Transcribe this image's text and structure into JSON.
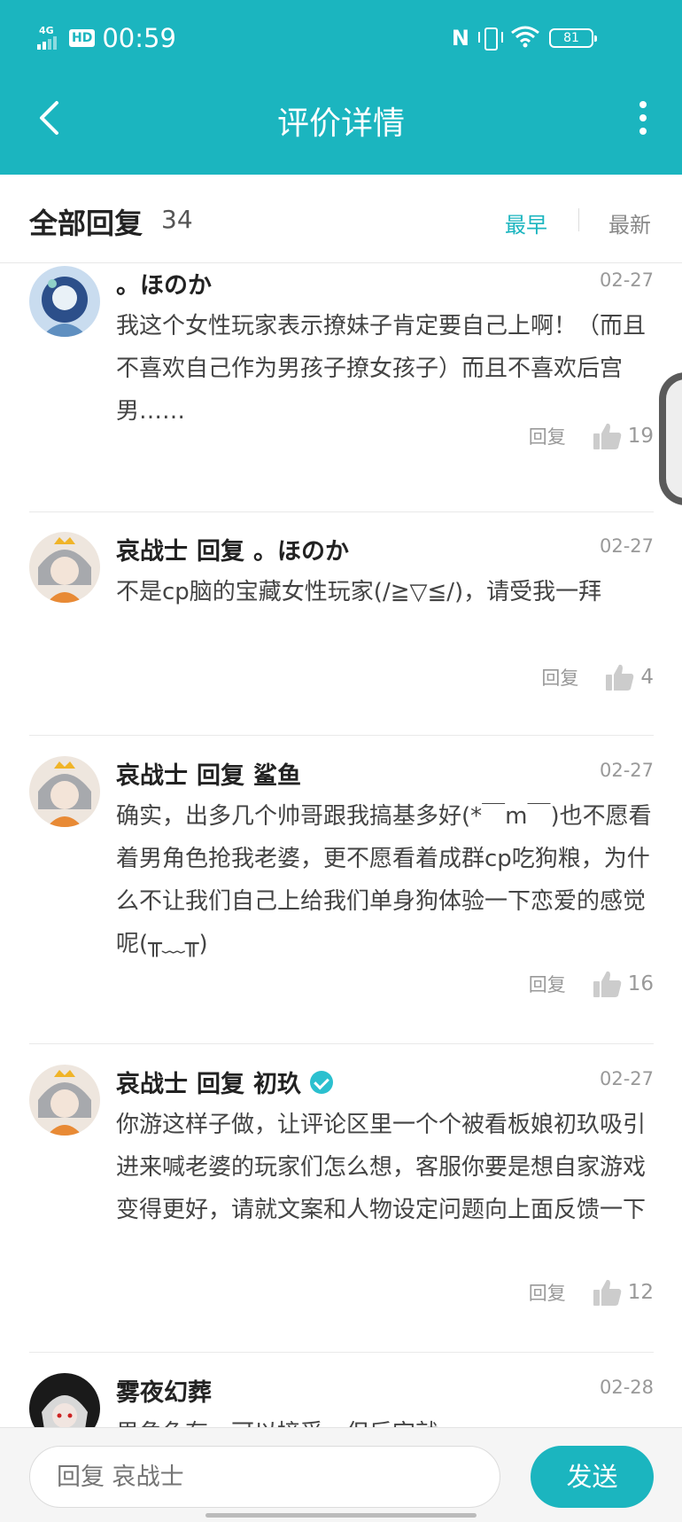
{
  "status_bar": {
    "network": "4G",
    "hd": "HD",
    "time": "00:59",
    "nfc": "N",
    "battery": "81"
  },
  "header": {
    "title": "评价详情"
  },
  "sort_bar": {
    "all_replies_label": "全部回复",
    "count": "34",
    "sort_earliest": "最早",
    "sort_latest": "最新"
  },
  "comments": [
    {
      "author": "。ほのか",
      "reply_word": "",
      "reply_to": "",
      "date": "02-27",
      "text": "我这个女性玩家表示撩妹子肯定要自己上啊！（而且不喜欢自己作为男孩子撩女孩子）而且不喜欢后宫男……",
      "reply_label": "回复",
      "likes": "19"
    },
    {
      "author": "哀战士",
      "reply_word": "回复",
      "reply_to": "。ほのか",
      "date": "02-27",
      "text": "不是cp脑的宝藏女性玩家(/≧▽≦/)，请受我一拜",
      "reply_label": "回复",
      "likes": "4"
    },
    {
      "author": "哀战士",
      "reply_word": "回复",
      "reply_to": "鲨鱼",
      "date": "02-27",
      "text": "确实，出多几个帅哥跟我搞基多好(*￣m￣)也不愿看着男角色抢我老婆，更不愿看着成群cp吃狗粮，为什么不让我们自己上给我们单身狗体验一下恋爱的感觉呢(╥﹏╥)",
      "reply_label": "回复",
      "likes": "16"
    },
    {
      "author": "哀战士",
      "reply_word": "回复",
      "reply_to": "初玖",
      "date": "02-27",
      "text": "你游这样子做，让评论区里一个个被看板娘初玖吸引进来喊老婆的玩家们怎么想，客服你要是想自家游戏变得更好，请就文案和人物设定问题向上面反馈一下",
      "reply_label": "回复",
      "likes": "12"
    },
    {
      "author": "雾夜幻葬",
      "reply_word": "",
      "reply_to": "",
      "date": "02-28",
      "text": "男角色有，可以接受，但后宫就",
      "reply_label": "",
      "likes": ""
    }
  ],
  "bottom_bar": {
    "input_placeholder": "回复 哀战士",
    "send_label": "发送"
  },
  "colors": {
    "accent": "#1bb5bf",
    "header_text": "#ffffff",
    "muted": "#999999"
  }
}
